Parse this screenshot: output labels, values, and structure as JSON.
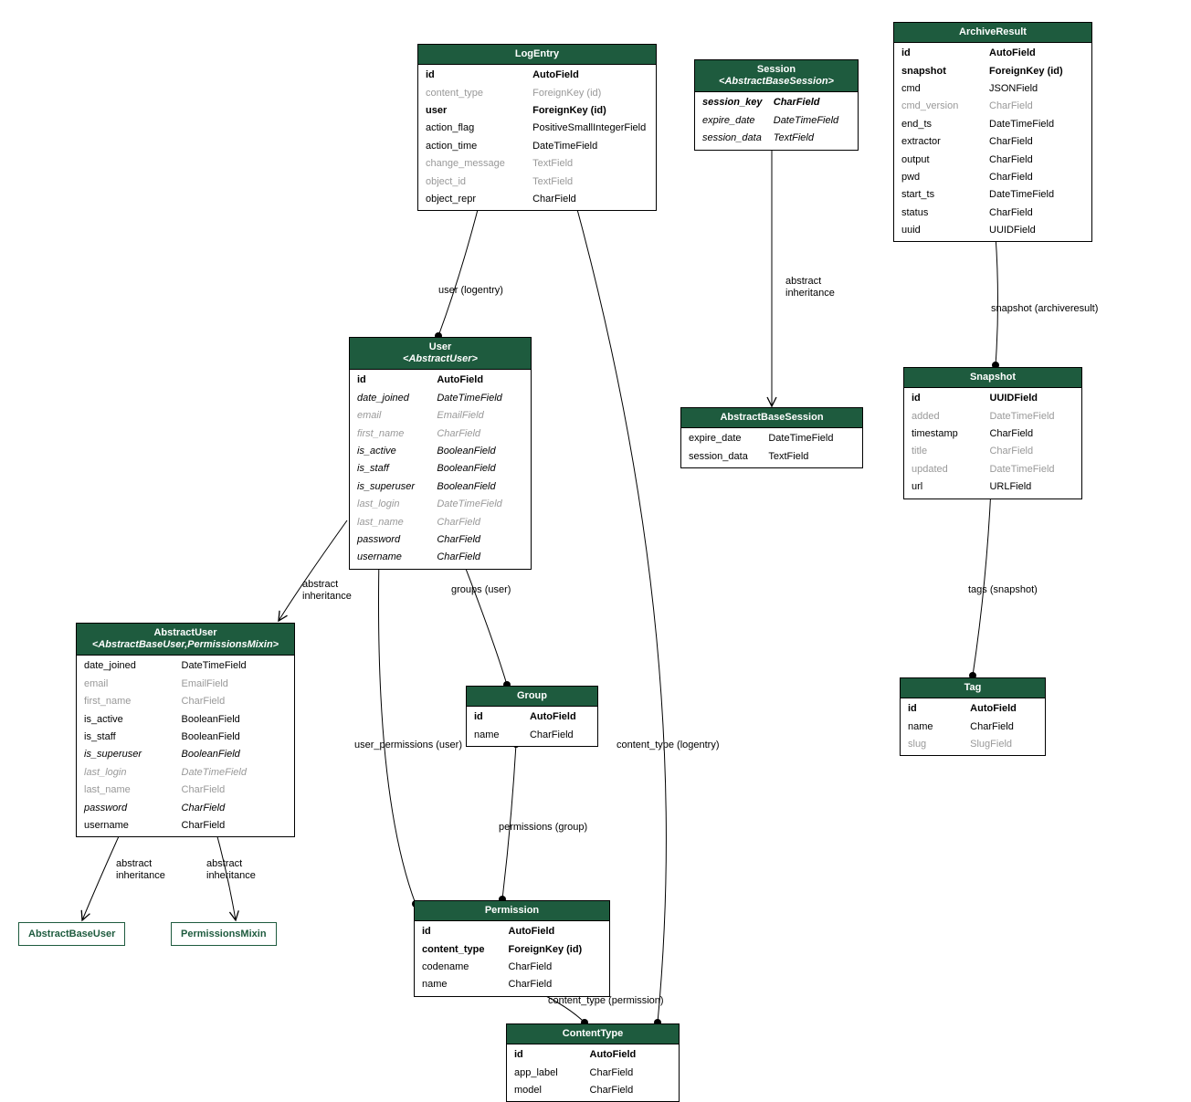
{
  "models": {
    "LogEntry": {
      "title": "LogEntry",
      "fields": [
        {
          "name": "id",
          "type": "AutoField",
          "bold": true
        },
        {
          "name": "content_type",
          "type": "ForeignKey (id)",
          "muted": true
        },
        {
          "name": "user",
          "type": "ForeignKey (id)",
          "bold": true
        },
        {
          "name": "action_flag",
          "type": "PositiveSmallIntegerField"
        },
        {
          "name": "action_time",
          "type": "DateTimeField"
        },
        {
          "name": "change_message",
          "type": "TextField",
          "muted": true
        },
        {
          "name": "object_id",
          "type": "TextField",
          "muted": true
        },
        {
          "name": "object_repr",
          "type": "CharField"
        }
      ]
    },
    "Session": {
      "title": "Session",
      "subtitle": "<AbstractBaseSession>",
      "fields": [
        {
          "name": "session_key",
          "type": "CharField",
          "bold": true,
          "italic": true
        },
        {
          "name": "expire_date",
          "type": "DateTimeField",
          "italic": true
        },
        {
          "name": "session_data",
          "type": "TextField",
          "italic": true
        }
      ]
    },
    "ArchiveResult": {
      "title": "ArchiveResult",
      "fields": [
        {
          "name": "id",
          "type": "AutoField",
          "bold": true
        },
        {
          "name": "snapshot",
          "type": "ForeignKey (id)",
          "bold": true
        },
        {
          "name": "cmd",
          "type": "JSONField"
        },
        {
          "name": "cmd_version",
          "type": "CharField",
          "muted": true
        },
        {
          "name": "end_ts",
          "type": "DateTimeField"
        },
        {
          "name": "extractor",
          "type": "CharField"
        },
        {
          "name": "output",
          "type": "CharField"
        },
        {
          "name": "pwd",
          "type": "CharField"
        },
        {
          "name": "start_ts",
          "type": "DateTimeField"
        },
        {
          "name": "status",
          "type": "CharField"
        },
        {
          "name": "uuid",
          "type": "UUIDField"
        }
      ]
    },
    "User": {
      "title": "User",
      "subtitle": "<AbstractUser>",
      "fields": [
        {
          "name": "id",
          "type": "AutoField",
          "bold": true
        },
        {
          "name": "date_joined",
          "type": "DateTimeField",
          "italic": true
        },
        {
          "name": "email",
          "type": "EmailField",
          "muted": true,
          "italic": true
        },
        {
          "name": "first_name",
          "type": "CharField",
          "muted": true,
          "italic": true
        },
        {
          "name": "is_active",
          "type": "BooleanField",
          "italic": true
        },
        {
          "name": "is_staff",
          "type": "BooleanField",
          "italic": true
        },
        {
          "name": "is_superuser",
          "type": "BooleanField",
          "italic": true
        },
        {
          "name": "last_login",
          "type": "DateTimeField",
          "muted": true,
          "italic": true
        },
        {
          "name": "last_name",
          "type": "CharField",
          "muted": true,
          "italic": true
        },
        {
          "name": "password",
          "type": "CharField",
          "italic": true
        },
        {
          "name": "username",
          "type": "CharField",
          "italic": true
        }
      ]
    },
    "AbstractBaseSession": {
      "title": "AbstractBaseSession",
      "fields": [
        {
          "name": "expire_date",
          "type": "DateTimeField"
        },
        {
          "name": "session_data",
          "type": "TextField"
        }
      ]
    },
    "Snapshot": {
      "title": "Snapshot",
      "fields": [
        {
          "name": "id",
          "type": "UUIDField",
          "bold": true
        },
        {
          "name": "added",
          "type": "DateTimeField",
          "muted": true
        },
        {
          "name": "timestamp",
          "type": "CharField"
        },
        {
          "name": "title",
          "type": "CharField",
          "muted": true
        },
        {
          "name": "updated",
          "type": "DateTimeField",
          "muted": true
        },
        {
          "name": "url",
          "type": "URLField"
        }
      ]
    },
    "AbstractUser": {
      "title": "AbstractUser",
      "subtitle": "<AbstractBaseUser,PermissionsMixin>",
      "fields": [
        {
          "name": "date_joined",
          "type": "DateTimeField"
        },
        {
          "name": "email",
          "type": "EmailField",
          "muted": true
        },
        {
          "name": "first_name",
          "type": "CharField",
          "muted": true
        },
        {
          "name": "is_active",
          "type": "BooleanField"
        },
        {
          "name": "is_staff",
          "type": "BooleanField"
        },
        {
          "name": "is_superuser",
          "type": "BooleanField",
          "italic": true
        },
        {
          "name": "last_login",
          "type": "DateTimeField",
          "muted": true,
          "italic": true
        },
        {
          "name": "last_name",
          "type": "CharField",
          "muted": true
        },
        {
          "name": "password",
          "type": "CharField",
          "italic": true
        },
        {
          "name": "username",
          "type": "CharField"
        }
      ]
    },
    "Group": {
      "title": "Group",
      "fields": [
        {
          "name": "id",
          "type": "AutoField",
          "bold": true
        },
        {
          "name": "name",
          "type": "CharField"
        }
      ]
    },
    "Tag": {
      "title": "Tag",
      "fields": [
        {
          "name": "id",
          "type": "AutoField",
          "bold": true
        },
        {
          "name": "name",
          "type": "CharField"
        },
        {
          "name": "slug",
          "type": "SlugField",
          "muted": true
        }
      ]
    },
    "Permission": {
      "title": "Permission",
      "fields": [
        {
          "name": "id",
          "type": "AutoField",
          "bold": true
        },
        {
          "name": "content_type",
          "type": "ForeignKey (id)",
          "bold": true
        },
        {
          "name": "codename",
          "type": "CharField"
        },
        {
          "name": "name",
          "type": "CharField"
        }
      ]
    },
    "ContentType": {
      "title": "ContentType",
      "fields": [
        {
          "name": "id",
          "type": "AutoField",
          "bold": true
        },
        {
          "name": "app_label",
          "type": "CharField"
        },
        {
          "name": "model",
          "type": "CharField"
        }
      ]
    }
  },
  "labels": {
    "AbstractBaseUser": "AbstractBaseUser",
    "PermissionsMixin": "PermissionsMixin"
  },
  "edgeLabels": {
    "user_logentry": "user (logentry)",
    "abstract_inheritance_1": "abstract\ninheritance",
    "snapshot_archiveresult": "snapshot (archiveresult)",
    "abstract_inheritance_2": "abstract\ninheritance",
    "groups_user": "groups (user)",
    "tags_snapshot": "tags (snapshot)",
    "user_permissions_user": "user_permissions (user)",
    "content_type_logentry": "content_type (logentry)",
    "permissions_group": "permissions (group)",
    "abstract_inheritance_3": "abstract\ninheritance",
    "abstract_inheritance_4": "abstract\ninheritance",
    "content_type_permission": "content_type (permission)"
  }
}
